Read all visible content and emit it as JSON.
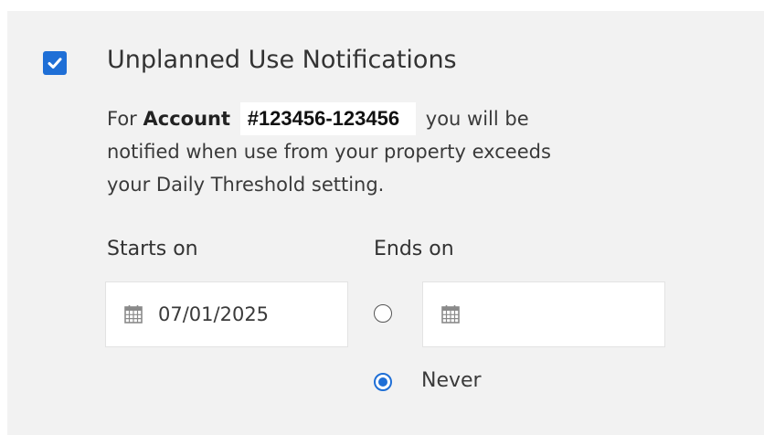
{
  "notification": {
    "enabled": true,
    "title": "Unplanned Use Notifications",
    "desc_for": "For",
    "desc_account_label": "Account",
    "desc_account_number": "#123456-123456",
    "desc_line1_tail": "you will be",
    "desc_line2": "notified when use from your property exceeds",
    "desc_line3": "your Daily Threshold setting."
  },
  "starts": {
    "label": "Starts on",
    "date_value": "07/01/2025"
  },
  "ends": {
    "label": "Ends on",
    "date_value": "",
    "date_radio_selected": false,
    "never_label": "Never",
    "never_selected": true
  },
  "colors": {
    "accent": "#1f6fd6",
    "panel_bg": "#f2f2f2"
  },
  "icons": {
    "checkbox": "checkmark-icon",
    "date": "calendar-icon"
  }
}
